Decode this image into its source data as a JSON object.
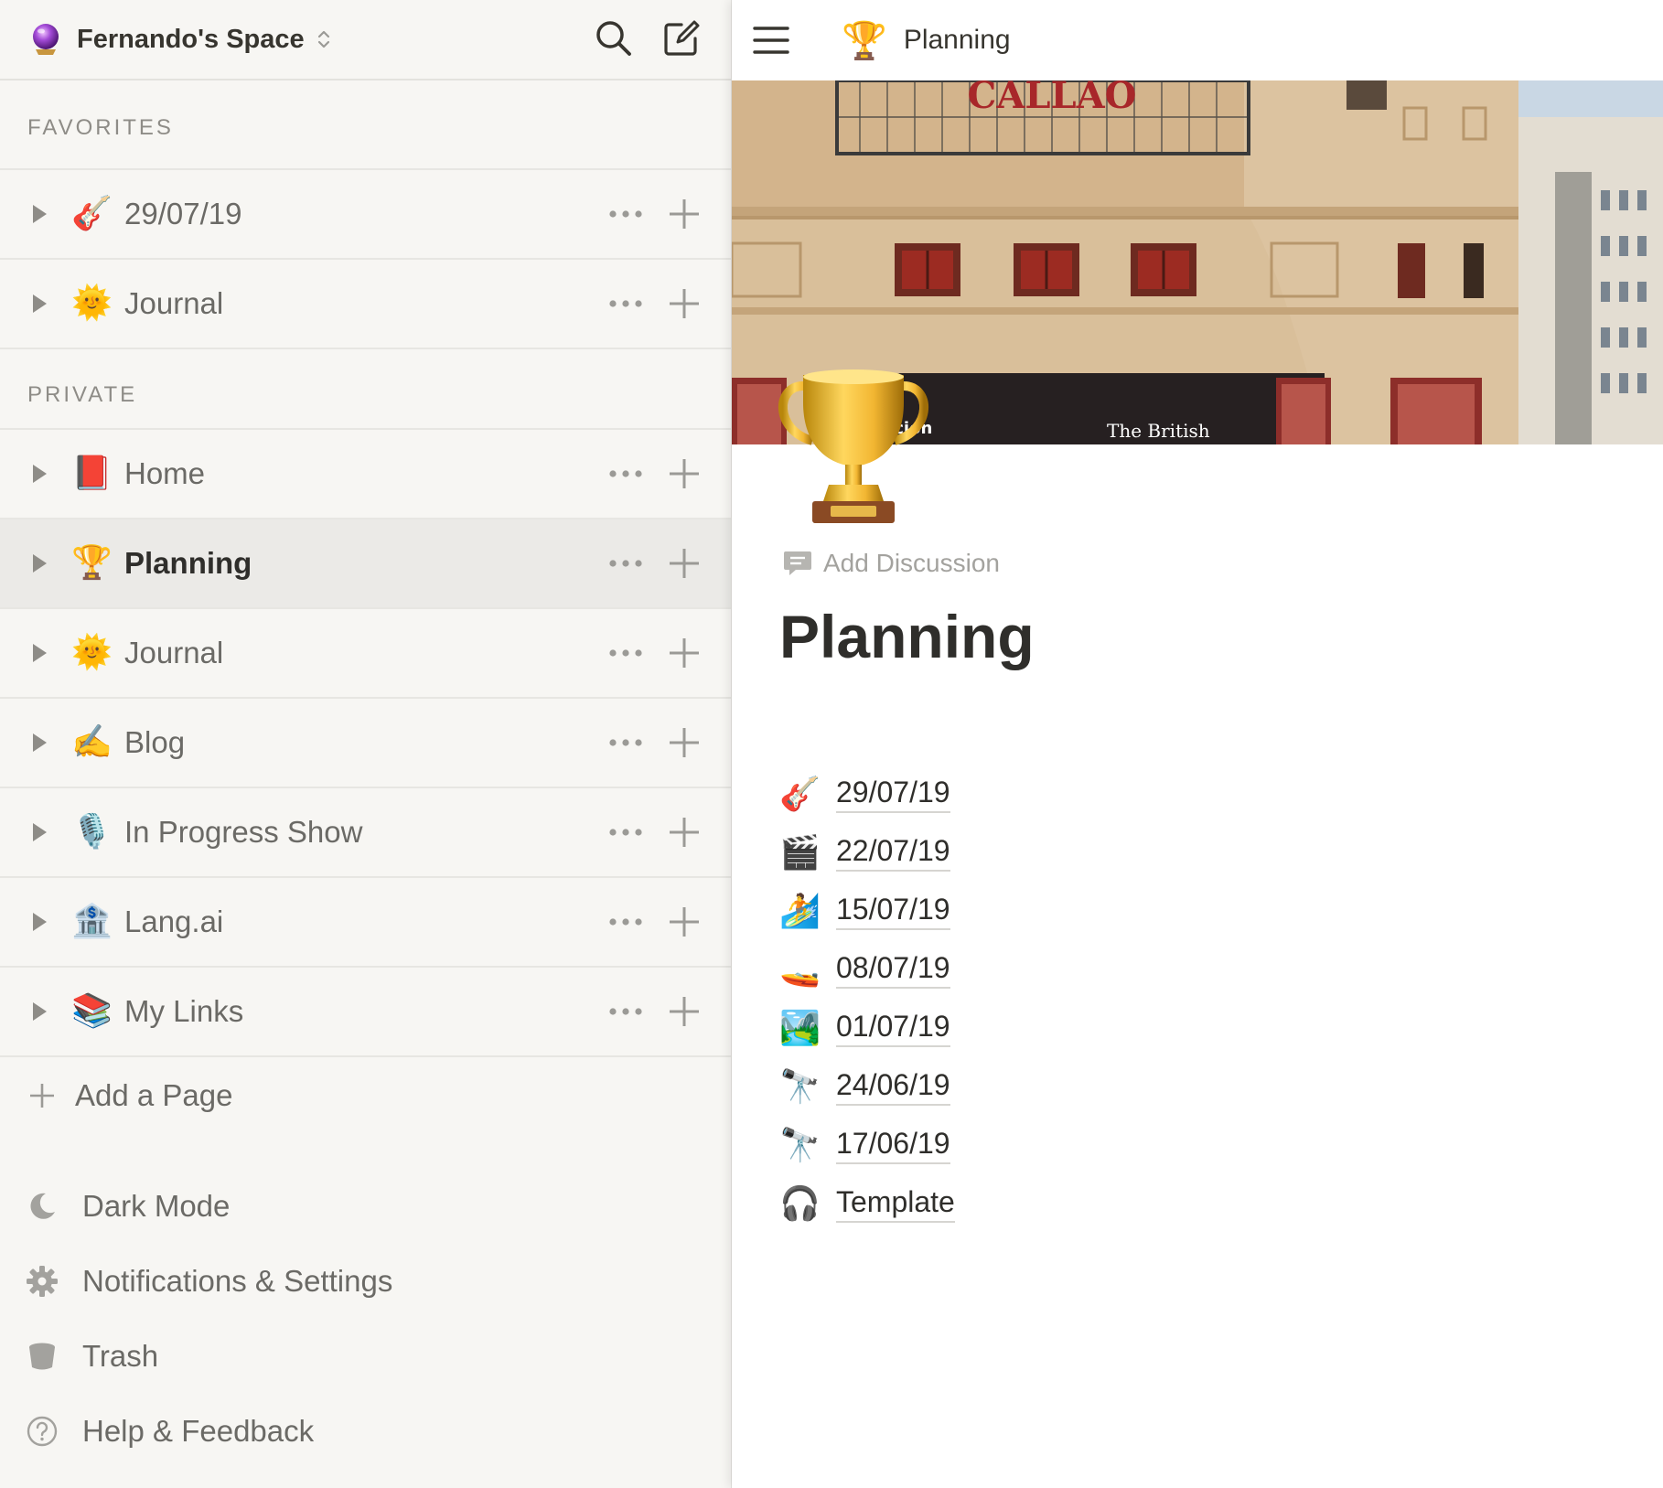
{
  "sidebar": {
    "workspace_name": "Fernando's Space",
    "favorites_label": "FAVORITES",
    "private_label": "PRIVATE",
    "favorites": [
      {
        "emoji": "🎸",
        "label": "29/07/19"
      },
      {
        "emoji": "🌞",
        "label": "Journal"
      }
    ],
    "private": [
      {
        "emoji": "📕",
        "label": "Home"
      },
      {
        "emoji": "🏆",
        "label": "Planning"
      },
      {
        "emoji": "🌞",
        "label": "Journal"
      },
      {
        "emoji": "✍️",
        "label": "Blog"
      },
      {
        "emoji": "🎙️",
        "label": "In Progress Show"
      },
      {
        "emoji": "🏦",
        "label": "Lang.ai"
      },
      {
        "emoji": "📚",
        "label": "My Links"
      }
    ],
    "add_page_label": "Add a Page",
    "utilities": {
      "dark_mode": "Dark Mode",
      "settings": "Notifications & Settings",
      "trash": "Trash",
      "help": "Help & Feedback"
    }
  },
  "topbar": {
    "emoji": "🏆",
    "title": "Planning"
  },
  "cover": {
    "sign_text": "CALLAO",
    "banner_left": "osición",
    "banner_right": "The British"
  },
  "page": {
    "add_discussion": "Add Discussion",
    "title": "Planning",
    "children": [
      {
        "emoji": "🎸",
        "label": "29/07/19"
      },
      {
        "emoji": "🎬",
        "label": "22/07/19"
      },
      {
        "emoji": "🏄",
        "label": "15/07/19"
      },
      {
        "emoji": "🚤",
        "label": "08/07/19"
      },
      {
        "emoji": "🏞️",
        "label": "01/07/19"
      },
      {
        "emoji": "🔭",
        "label": "24/06/19"
      },
      {
        "emoji": "🔭",
        "label": "17/06/19"
      },
      {
        "emoji": "🎧",
        "label": "Template"
      }
    ]
  },
  "colors": {
    "sidebar_bg": "#f7f6f3",
    "active_row_bg": "#ebeae7",
    "text_primary": "#37352f",
    "text_secondary": "#6b6a66"
  }
}
